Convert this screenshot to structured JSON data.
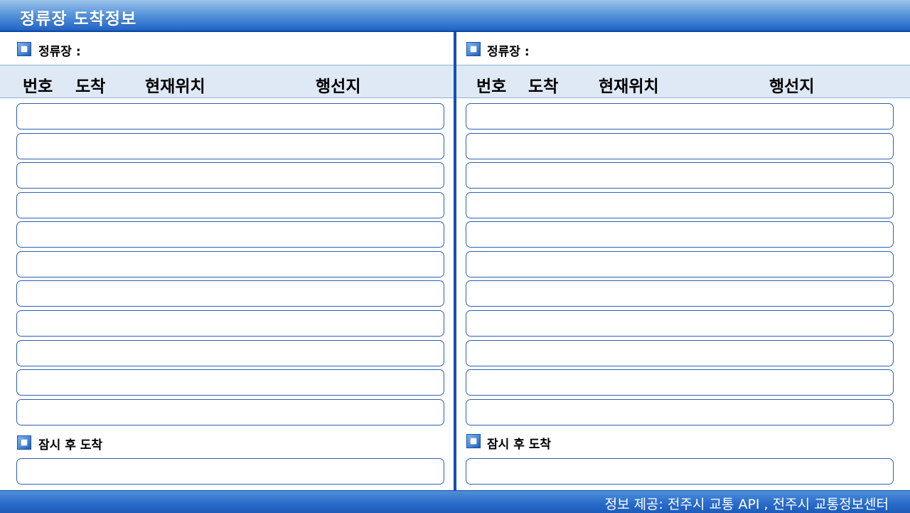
{
  "app": {
    "title": "정류장 도착정보"
  },
  "panels": [
    {
      "station_label": "정류장 :",
      "headers": [
        "번호",
        "도착",
        "현재위치",
        "행선지"
      ],
      "arrival_rows": [
        "",
        "",
        "",
        "",
        "",
        "",
        "",
        "",
        "",
        "",
        ""
      ],
      "later_label": "잠시 후 도착",
      "later_rows": [
        ""
      ]
    },
    {
      "station_label": "정류장 :",
      "headers": [
        "번호",
        "도착",
        "현재위치",
        "행선지"
      ],
      "arrival_rows": [
        "",
        "",
        "",
        "",
        "",
        "",
        "",
        "",
        "",
        "",
        ""
      ],
      "later_label": "잠시 후 도착",
      "later_rows": [
        ""
      ]
    }
  ],
  "footer": {
    "credit": "정보 제공: 전주시 교통 API , 전주시 교통정보센터"
  },
  "colors": {
    "accent": "#1f63c6",
    "divider": "#1450b4",
    "row_border": "#2e5fb2",
    "header_bg": "#dfe9f6"
  },
  "icons": [
    "square-bullet-icon"
  ]
}
